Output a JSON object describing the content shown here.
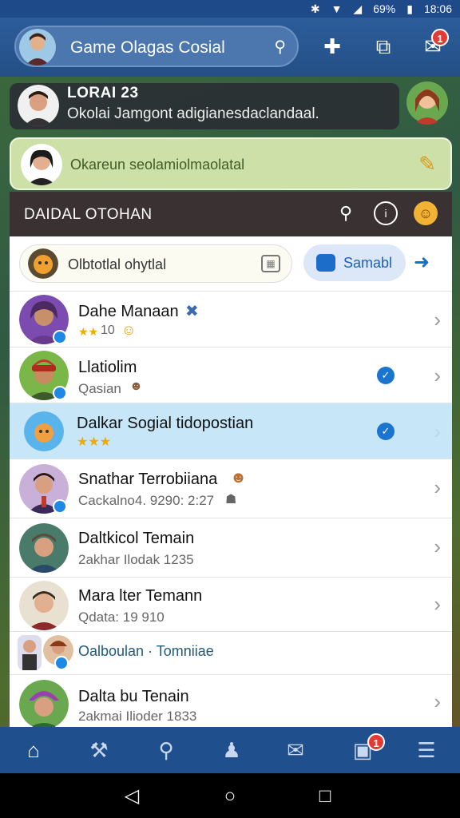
{
  "status": {
    "battery": "69%",
    "time": "18:06"
  },
  "header": {
    "title": "Game Olagas Cosial",
    "notification_count": "1"
  },
  "banner": {
    "title": "LORAI 23",
    "text": "Okolai Jamgont adigianesdaclandaal."
  },
  "compose": {
    "placeholder": "Okareun seolamiolmaolatal"
  },
  "section": {
    "title": "DAIDAL OTOHAN"
  },
  "filter": {
    "text": "Olbtotlal ohytlal",
    "button_label": "Samabl"
  },
  "contacts": [
    {
      "name": "Dahe Manaan",
      "sub": "10"
    },
    {
      "name": "Llatiolim",
      "sub": "Qasian"
    },
    {
      "name": "Dalkar Sogial tidopostian",
      "sub": ""
    },
    {
      "name": "Snathar Terrobiiana",
      "sub": "Cackalno4. 9290: 2:27"
    },
    {
      "name": "Daltkicol Temain",
      "sub": "2akhar   Ilodak 1235"
    },
    {
      "name": "Mara lter Temann",
      "sub": "Qdata: 19 910"
    },
    {
      "name": "Oalboulan · Tomniiae",
      "sub": ""
    },
    {
      "name": "Dalta bu Tenain",
      "sub": "2akmai   Ilioder 1833"
    }
  ],
  "bottom_nav": {
    "badge": "1"
  },
  "colors": {
    "accent": "#1b75d0",
    "header": "#2c5d9a",
    "selected": "#c7e6f7"
  }
}
